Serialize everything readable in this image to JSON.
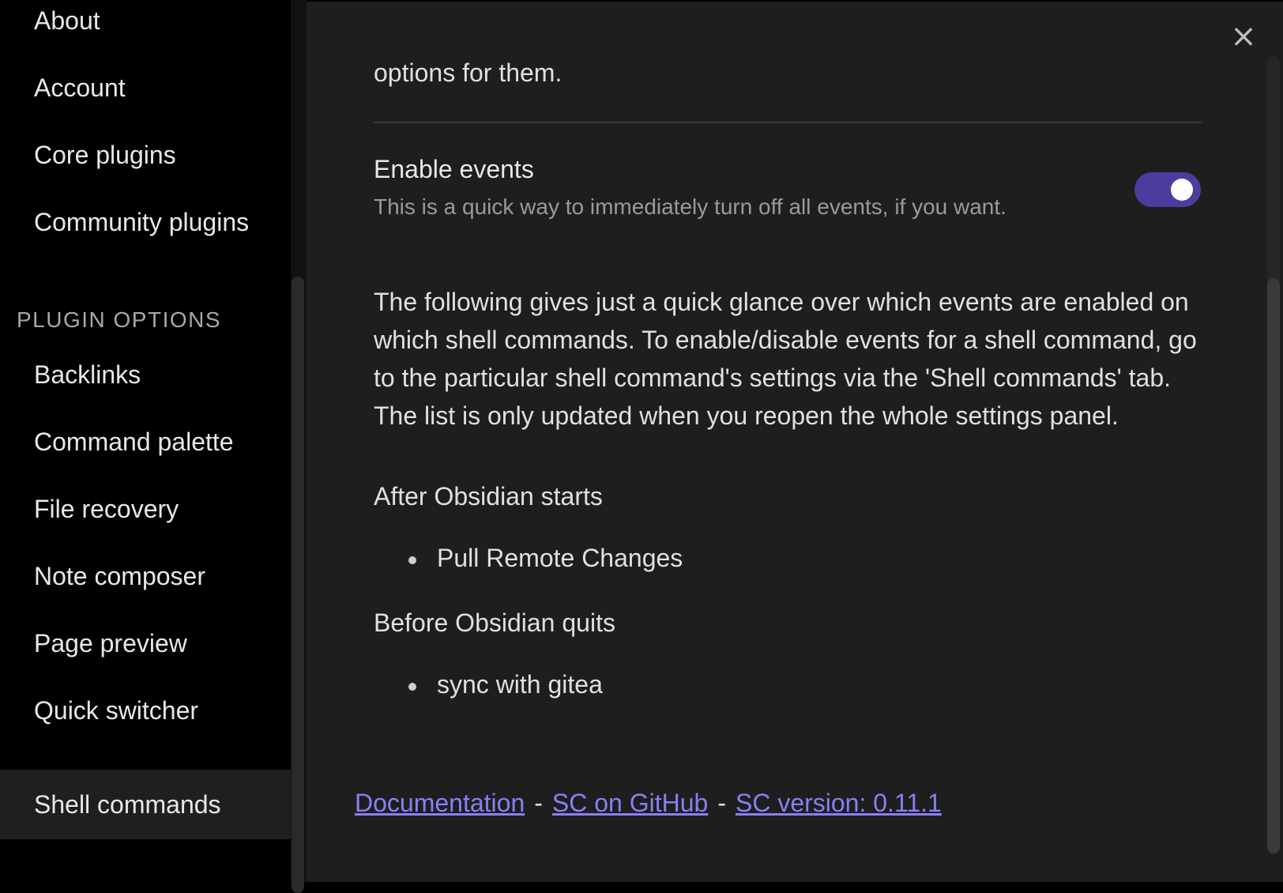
{
  "sidebar": {
    "items_top": [
      {
        "label": "About"
      },
      {
        "label": "Account"
      },
      {
        "label": "Core plugins"
      },
      {
        "label": "Community plugins"
      }
    ],
    "heading": "PLUGIN OPTIONS",
    "items_plugins": [
      {
        "label": "Backlinks"
      },
      {
        "label": "Command palette"
      },
      {
        "label": "File recovery"
      },
      {
        "label": "Note composer"
      },
      {
        "label": "Page preview"
      },
      {
        "label": "Quick switcher"
      },
      {
        "label": "Shell commands",
        "active": true
      }
    ]
  },
  "main": {
    "close_icon": "×",
    "intro_text": "options for them.",
    "enable_events": {
      "name": "Enable events",
      "description": "This is a quick way to immediately turn off all events, if you want.",
      "enabled": true
    },
    "paragraph": "The following gives just a quick glance over which events are enabled on which shell commands. To enable/disable events for a shell command, go to the particular shell command's settings via the 'Shell commands' tab. The list is only updated when you reopen the whole settings panel.",
    "events": [
      {
        "heading": "After Obsidian starts",
        "commands": [
          "Pull Remote Changes"
        ]
      },
      {
        "heading": "Before Obsidian quits",
        "commands": [
          "sync with gitea"
        ]
      }
    ],
    "footer": {
      "documentation_link": "Documentation",
      "separator": "-",
      "github_link": "SC on GitHub",
      "version_link": "SC version: 0.11.1"
    }
  },
  "colors": {
    "accent": "#4b3d9e",
    "link": "#8b7ff5",
    "background": "#1e1e1e",
    "sidebar_background": "#000000"
  }
}
